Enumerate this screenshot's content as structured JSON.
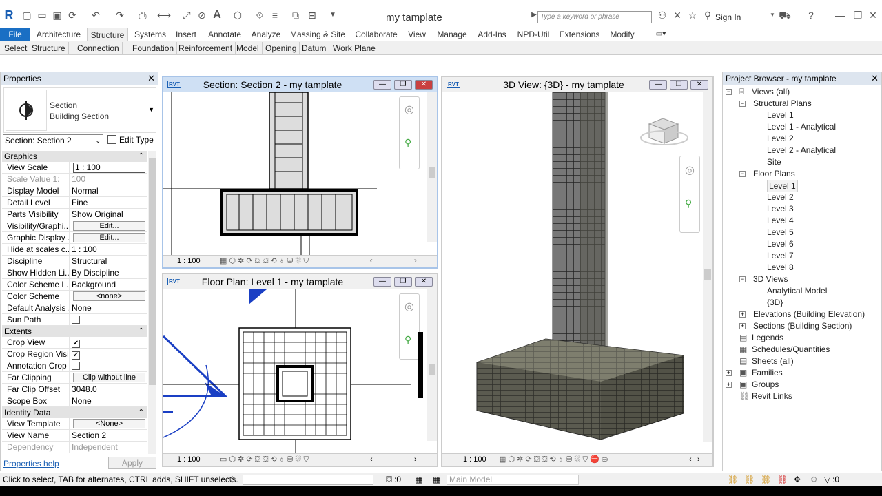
{
  "app": {
    "title": "my tamplate",
    "search_placeholder": "Type a keyword or phrase",
    "sign_in": "Sign In",
    "accent": "#1a6fc4"
  },
  "ribbon": {
    "tabs": [
      "File",
      "Architecture",
      "Structure",
      "Systems",
      "Insert",
      "Annotate",
      "Analyze",
      "Massing & Site",
      "Collaborate",
      "View",
      "Manage",
      "Add-Ins",
      "NPD-Util",
      "Extensions",
      "Modify"
    ],
    "panels": [
      "Select",
      "Structure",
      "Connection",
      "Foundation",
      "Reinforcement",
      "Model",
      "Opening",
      "Datum",
      "Work Plane"
    ]
  },
  "properties": {
    "title": "Properties",
    "type_name": "Section",
    "type_sub": "Building Section",
    "selector": "Section: Section 2",
    "edit_type": "Edit Type",
    "graphics": {
      "header": "Graphics",
      "rows": [
        {
          "k": "View Scale",
          "v": "1 : 100"
        },
        {
          "k": "Scale Value    1:",
          "v": "100"
        },
        {
          "k": "Display Model",
          "v": "Normal"
        },
        {
          "k": "Detail Level",
          "v": "Fine"
        },
        {
          "k": "Parts Visibility",
          "v": "Show Original"
        },
        {
          "k": "Visibility/Graphi...",
          "v": "Edit..."
        },
        {
          "k": "Graphic Display ...",
          "v": "Edit..."
        },
        {
          "k": "Hide at scales c...",
          "v": "1 : 100"
        },
        {
          "k": "Discipline",
          "v": "Structural"
        },
        {
          "k": "Show Hidden Li...",
          "v": "By Discipline"
        },
        {
          "k": "Color Scheme L...",
          "v": "Background"
        },
        {
          "k": "Color Scheme",
          "v": "<none>"
        },
        {
          "k": "Default Analysis ...",
          "v": "None"
        },
        {
          "k": "Sun Path",
          "v": ""
        }
      ]
    },
    "extents": {
      "header": "Extents",
      "rows": [
        {
          "k": "Crop View",
          "v": "✔"
        },
        {
          "k": "Crop Region Visi...",
          "v": "✔"
        },
        {
          "k": "Annotation Crop",
          "v": ""
        },
        {
          "k": "Far Clipping",
          "v": "Clip without line"
        },
        {
          "k": "Far Clip Offset",
          "v": "3048.0"
        },
        {
          "k": "Scope Box",
          "v": "None"
        }
      ]
    },
    "identity": {
      "header": "Identity Data",
      "rows": [
        {
          "k": "View Template",
          "v": "<None>"
        },
        {
          "k": "View Name",
          "v": "Section 2"
        },
        {
          "k": "Dependency",
          "v": "Independent"
        }
      ]
    },
    "help": "Properties help",
    "apply": "Apply"
  },
  "views": {
    "section": {
      "title": "Section: Section 2 - my tamplate",
      "scale": "1 : 100"
    },
    "plan": {
      "title": "Floor Plan: Level 1 - my tamplate",
      "scale": "1 : 100"
    },
    "threed": {
      "title": "3D View: {3D} - my tamplate",
      "scale": "1 : 100"
    }
  },
  "browser": {
    "title": "Project Browser - my tamplate",
    "nodes": [
      "Views (all)",
      "Structural Plans",
      "Level 1",
      "Level 1 - Analytical",
      "Level 2",
      "Level 2 - Analytical",
      "Site",
      "Floor Plans",
      "Level 1",
      "Level 2",
      "Level 3",
      "Level 4",
      "Level 5",
      "Level 6",
      "Level 7",
      "Level 8",
      "3D Views",
      "Analytical Model",
      "{3D}",
      "Elevations (Building Elevation)",
      "Sections (Building Section)",
      "Legends",
      "Schedules/Quantities",
      "Sheets (all)",
      "Families",
      "Groups",
      "Revit Links"
    ]
  },
  "status": {
    "text": "Click to select, TAB for alternates, CTRL adds, SHIFT unselects.",
    "selcount": ":0",
    "model": "Main Model",
    "filter": ":0"
  }
}
